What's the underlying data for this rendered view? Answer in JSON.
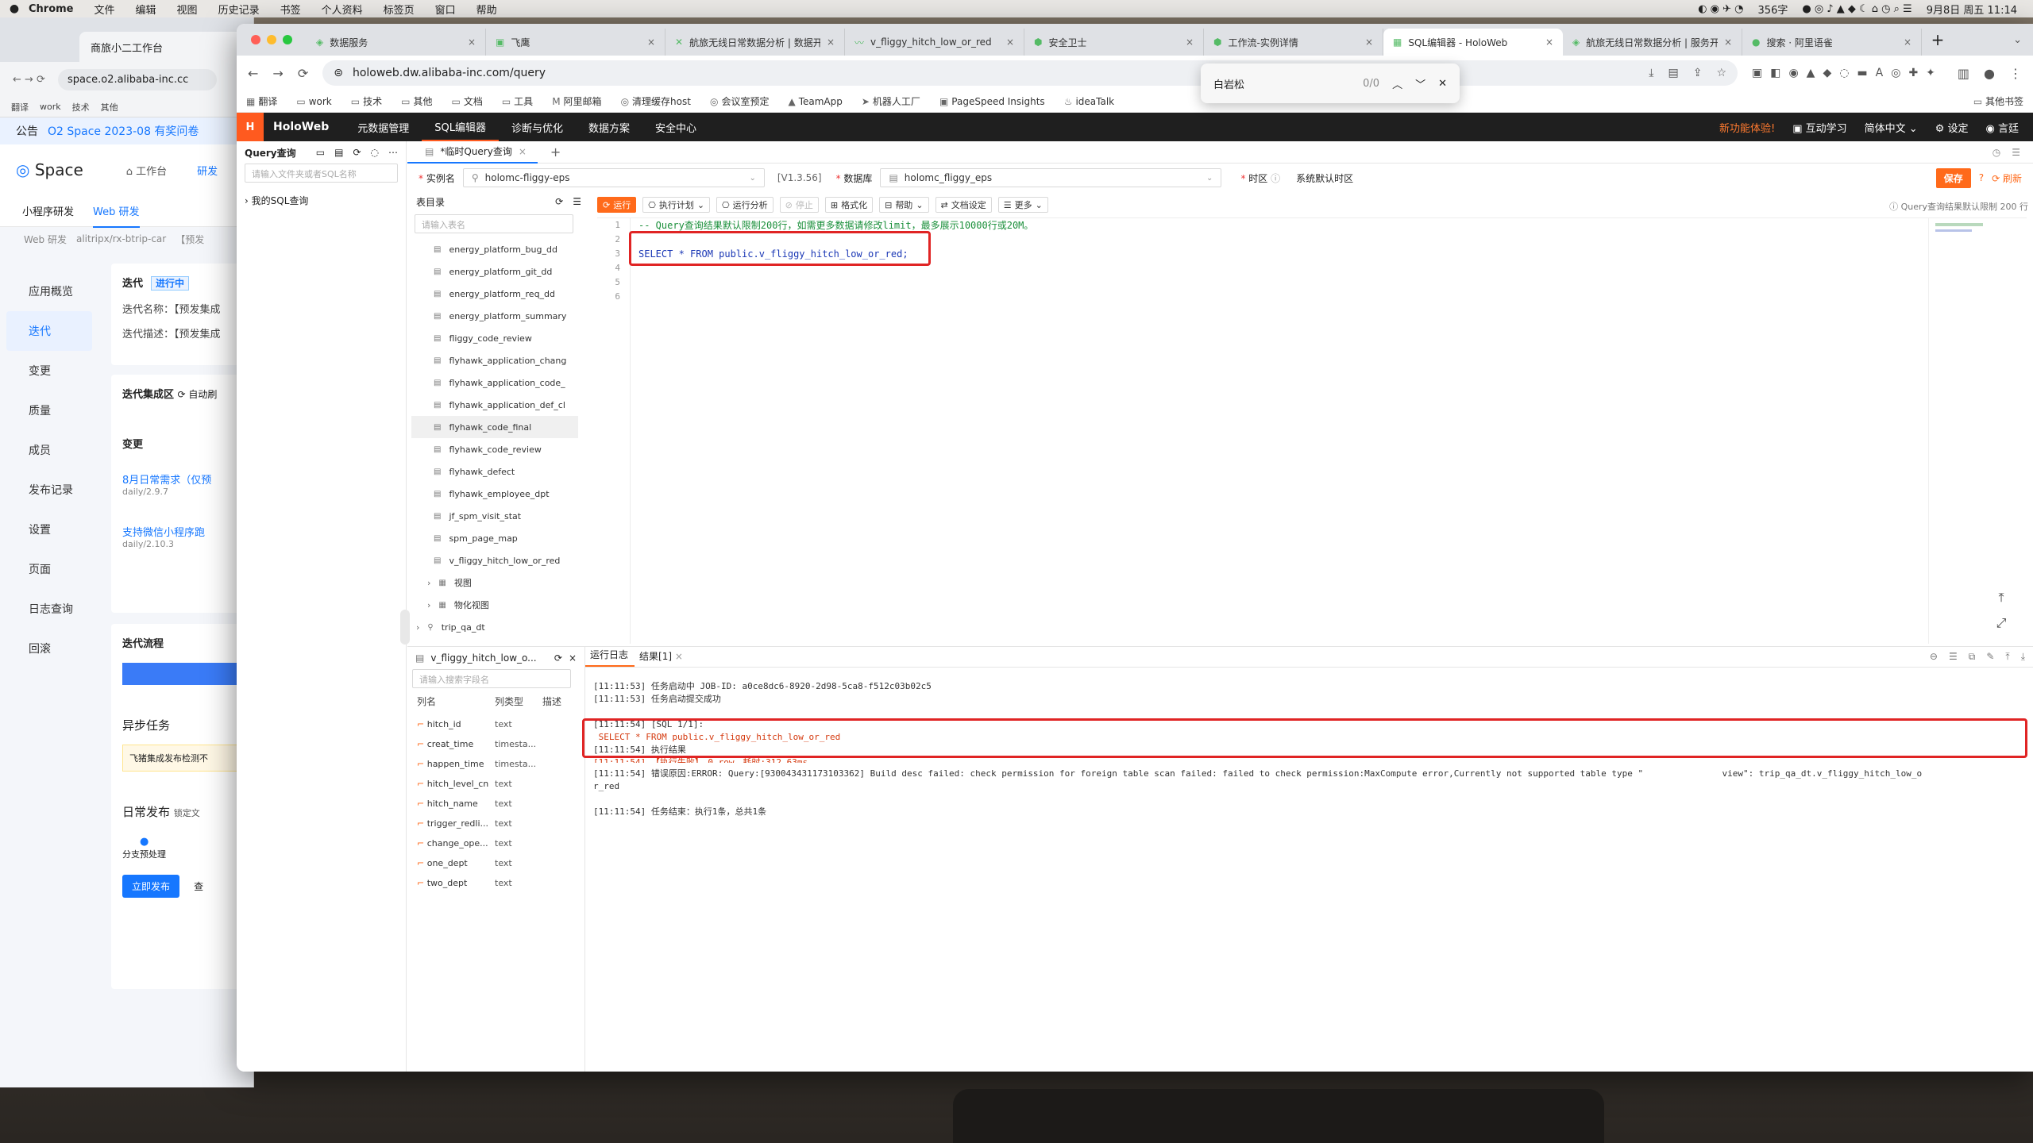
{
  "menubar": {
    "app": "Chrome",
    "items": [
      "文件",
      "编辑",
      "视图",
      "历史记录",
      "书签",
      "个人资料",
      "标签页",
      "窗口",
      "帮助"
    ],
    "right": {
      "word_count": "356字",
      "datetime": "9月8日 周五 11:14"
    }
  },
  "back_window": {
    "tab": "商旅小二工作台",
    "url": "space.o2.alibaba-inc.cc",
    "bookmarks": [
      "翻译",
      "work",
      "技术",
      "其他"
    ],
    "notice_label": "公告",
    "notice_text": "O2 Space 2023-08 有奖问卷",
    "logo": "Space",
    "header_link": "工作台",
    "header_right": "研发",
    "subnav": [
      "小程序研发",
      "Web 研发"
    ],
    "crumb": [
      "Web 研发",
      "alitripx/rx-btrip-car",
      "【预发"
    ],
    "sidenav": [
      "应用概览",
      "迭代",
      "变更",
      "质量",
      "成员",
      "发布记录",
      "设置",
      "页面",
      "日志查询",
      "回滚"
    ],
    "iter_title": "迭代",
    "iter_status": "进行中",
    "iter_name_label": "迭代名称：",
    "iter_name_value": "【预发集成",
    "iter_desc_label": "迭代描述：",
    "iter_desc_value": "【预发集成",
    "integration_title": "迭代集成区",
    "integration_auto": "自动刷",
    "change_title": "变更",
    "change1": "8月日常需求（仅预",
    "change1_branch": "daily/2.9.7",
    "change2": "支持微信小程序跑",
    "change2_branch": "daily/2.10.3",
    "flow_title": "迭代流程",
    "async_title": "异步任务",
    "async_text": "飞猪集成发布检测不",
    "daily_title": "日常发布",
    "daily_lock": "锁定文",
    "step": "分支预处理",
    "publish_btn": "立即发布",
    "publish_btn2": "查"
  },
  "tabs": [
    {
      "label": "数据服务",
      "icon": "◈"
    },
    {
      "label": "飞鹰",
      "icon": "▣"
    },
    {
      "label": "航旅无线日常数据分析 | 数据开",
      "icon": "✕"
    },
    {
      "label": "v_fliggy_hitch_low_or_red",
      "icon": "〰"
    },
    {
      "label": "安全卫士",
      "icon": "⬢"
    },
    {
      "label": "工作流-实例详情",
      "icon": "⬢"
    },
    {
      "label": "SQL编辑器 - HoloWeb",
      "icon": "▦",
      "active": true
    },
    {
      "label": "航旅无线日常数据分析 | 服务开",
      "icon": "◈"
    },
    {
      "label": "搜索 · 阿里语雀",
      "icon": "●"
    }
  ],
  "url": "holoweb.dw.alibaba-inc.com/query",
  "bookmarks": [
    {
      "label": "翻译",
      "icon": "▦"
    },
    {
      "label": "work",
      "icon": "▭"
    },
    {
      "label": "技术",
      "icon": "▭"
    },
    {
      "label": "其他",
      "icon": "▭"
    },
    {
      "label": "文档",
      "icon": "▭"
    },
    {
      "label": "工具",
      "icon": "▭"
    },
    {
      "label": "阿里邮箱",
      "icon": "M"
    },
    {
      "label": "清理缓存host",
      "icon": "◎"
    },
    {
      "label": "会议室预定",
      "icon": "◎"
    },
    {
      "label": "TeamApp",
      "icon": "▲"
    },
    {
      "label": "机器人工厂",
      "icon": "➤"
    },
    {
      "label": "PageSpeed Insights",
      "icon": "▣"
    },
    {
      "label": "ideaTalk",
      "icon": "♨"
    }
  ],
  "bookmarks_other": "其他书签",
  "find": {
    "query": "白岩松",
    "count": "0/0"
  },
  "app_header": {
    "logo": "H",
    "brand": "HoloWeb",
    "nav": [
      "元数据管理",
      "SQL编辑器",
      "诊断与优化",
      "数据方案",
      "安全中心"
    ],
    "active_nav": "SQL编辑器",
    "promo": "新功能体验!",
    "right": [
      "互动学习",
      "简体中文",
      "设定",
      "言廷"
    ]
  },
  "left_panel": {
    "title": "Query查询",
    "search_placeholder": "请输入文件夹或者SQL名称",
    "tree_item": "我的SQL查询"
  },
  "query_tab": "*临时Query查询",
  "params": {
    "instance_label": "实例名",
    "instance_value": "holomc-fliggy-eps",
    "version": "[V1.3.56]",
    "db_label": "数据库",
    "db_value": "holomc_fliggy_eps",
    "tz_label": "时区",
    "tz_value": "系统默认时区",
    "save": "保存",
    "refresh": "刷新"
  },
  "table_panel": {
    "title": "表目录",
    "search_placeholder": "请输入表名",
    "tables": [
      "energy_platform_bug_dd",
      "energy_platform_git_dd",
      "energy_platform_req_dd",
      "energy_platform_summary",
      "fliggy_code_review",
      "flyhawk_application_chang",
      "flyhawk_application_code_",
      "flyhawk_application_def_cl",
      "flyhawk_code_final",
      "flyhawk_code_review",
      "flyhawk_defect",
      "flyhawk_employee_dpt",
      "jf_spm_visit_stat",
      "spm_page_map",
      "v_fliggy_hitch_low_or_red"
    ],
    "groups": [
      "视图",
      "物化视图"
    ],
    "schema": "trip_qa_dt"
  },
  "editor_toolbar": {
    "buttons": [
      "运行",
      "执行计划",
      "运行分析",
      "停止",
      "格式化",
      "帮助",
      "文档设定",
      "更多"
    ],
    "limit_note": "Query查询结果默认限制 200 行"
  },
  "editor": {
    "lines": [
      "-- Query查询结果默认限制200行，如需更多数据请修改limit，最多展示10000行或20M。",
      "",
      "SELECT * FROM public.v_fliggy_hitch_low_or_red;",
      "",
      "",
      ""
    ]
  },
  "schema_panel": {
    "title": "v_fliggy_hitch_low_o...",
    "search_placeholder": "请输入搜索字段名",
    "headers": [
      "列名",
      "列类型",
      "描述"
    ],
    "columns": [
      {
        "name": "hitch_id",
        "type": "text"
      },
      {
        "name": "creat_time",
        "type": "timesta..."
      },
      {
        "name": "happen_time",
        "type": "timesta..."
      },
      {
        "name": "hitch_level_cn",
        "type": "text"
      },
      {
        "name": "hitch_name",
        "type": "text"
      },
      {
        "name": "trigger_redli...",
        "type": "text"
      },
      {
        "name": "change_ope...",
        "type": "text"
      },
      {
        "name": "one_dept",
        "type": "text"
      },
      {
        "name": "two_dept",
        "type": "text"
      }
    ]
  },
  "results": {
    "tabs": [
      "运行日志",
      "结果[1]"
    ],
    "log": [
      "[11:11:53] 任务启动中 JOB-ID: a0ce8dc6-8920-2d98-5ca8-f512c03b02c5",
      "[11:11:53] 任务启动提交成功",
      "[11:11:54] [SQL 1/1]:",
      " SELECT * FROM public.v_fliggy_hitch_low_or_red",
      "[11:11:54] 执行结果",
      "[11:11:54] 【执行失败】，0 row，耗时:312.63ms",
      "[11:11:54] 错误原因:ERROR: Query:[930043431173103362] Build desc failed: check permission for foreign table scan failed: failed to check permission:MaxCompute error,Currently not supported table type \"               view\": trip_qa_dt.v_fliggy_hitch_low_o",
      "r_red",
      "[11:11:54] 任务结束：执行1条，总共1条"
    ]
  },
  "colors": {
    "accent": "#ff6a1a",
    "link": "#1677ff",
    "error_box": "#e02424"
  }
}
